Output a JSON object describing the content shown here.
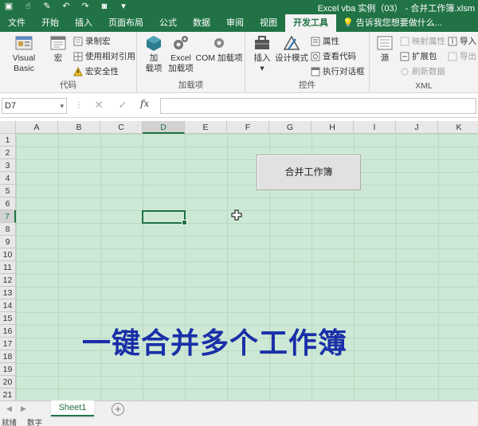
{
  "window": {
    "title": "Excel vba 实例（03） - 合并工作簿.xlsm"
  },
  "tabs": [
    {
      "label": "文件"
    },
    {
      "label": "开始"
    },
    {
      "label": "插入"
    },
    {
      "label": "页面布局"
    },
    {
      "label": "公式"
    },
    {
      "label": "数据"
    },
    {
      "label": "审阅"
    },
    {
      "label": "视图"
    },
    {
      "label": "开发工具",
      "active": true
    }
  ],
  "tellme": "告诉我您想要做什么...",
  "ribbon": {
    "code": {
      "label": "代码",
      "visual_basic": "Visual Basic",
      "macro": "宏",
      "record_macro": "录制宏",
      "relative_ref": "使用相对引用",
      "macro_security": "宏安全性"
    },
    "addins": {
      "label": "加载项",
      "addins_line1": "加",
      "addins_line2": "载项",
      "excel_line1": "Excel",
      "excel_line2": "加载项",
      "com": "COM 加载项"
    },
    "controls": {
      "label": "控件",
      "insert": "插入",
      "design_mode": "设计模式",
      "properties": "属性",
      "view_code": "查看代码",
      "run_dialog": "执行对话框"
    },
    "xml": {
      "label": "XML",
      "source": "源",
      "map_properties": "映射属性",
      "expansion_packs": "扩展包",
      "refresh_data": "刷新数据",
      "import": "导入",
      "export": "导出"
    }
  },
  "formula_bar": {
    "name_box": "D7",
    "fx": "fx",
    "content": ""
  },
  "sheet": {
    "columns": [
      "A",
      "B",
      "C",
      "D",
      "E",
      "F",
      "G",
      "H",
      "I",
      "J",
      "K"
    ],
    "rows": [
      "1",
      "2",
      "3",
      "4",
      "5",
      "6",
      "7",
      "8",
      "9",
      "10",
      "11",
      "12",
      "13",
      "14",
      "15",
      "16",
      "17",
      "18",
      "19",
      "20",
      "21"
    ],
    "selected_column": "D",
    "selected_row": "7",
    "merge_button_label": "合并工作簿",
    "overlay_caption": "一键合并多个工作簿"
  },
  "sheet_tabs": [
    {
      "label": "Sheet1",
      "active": true
    }
  ],
  "status": {
    "ready": "就绪",
    "numlock": "数字"
  },
  "colors": {
    "excel_green": "#217346",
    "sheet_bg": "#cde9d5",
    "caption_blue": "#1a2fa8"
  }
}
